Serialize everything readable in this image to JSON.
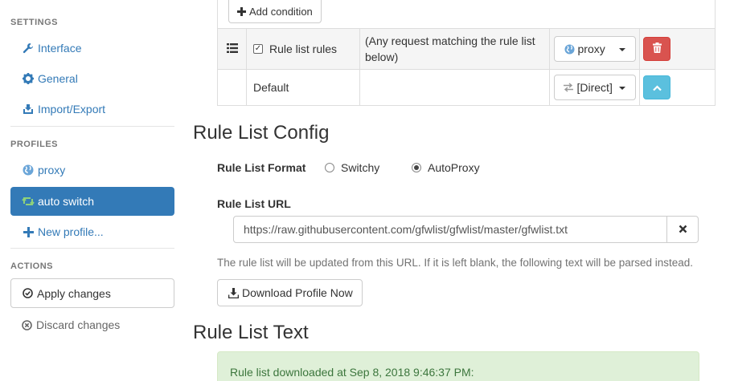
{
  "sidebar": {
    "settings_heading": "SETTINGS",
    "settings_items": [
      {
        "label": "Interface",
        "icon": "wrench-icon"
      },
      {
        "label": "General",
        "icon": "gear-icon"
      },
      {
        "label": "Import/Export",
        "icon": "import-export-icon"
      }
    ],
    "profiles_heading": "PROFILES",
    "profile_items": [
      {
        "label": "proxy",
        "icon": "globe-icon"
      },
      {
        "label": "auto switch",
        "icon": "retweet-icon"
      },
      {
        "label": "New profile...",
        "icon": "plus-icon"
      }
    ],
    "actions_heading": "ACTIONS",
    "apply_label": "Apply changes",
    "discard_label": "Discard changes"
  },
  "rules_table": {
    "add_condition_label": "Add condition",
    "rows": [
      {
        "name": "Rule list rules",
        "checked": true,
        "description": "(Any request matching the rule list below)",
        "profile": "proxy",
        "profile_icon": "globe-icon",
        "action_icon": "trash-icon"
      },
      {
        "name": "Default",
        "description": "",
        "profile": "[Direct]",
        "profile_icon": "transfer-icon",
        "action_icon": "chevron-up-icon"
      }
    ]
  },
  "rule_list_config": {
    "heading": "Rule List Config",
    "format_label": "Rule List Format",
    "format_options": [
      {
        "label": "Switchy",
        "selected": false
      },
      {
        "label": "AutoProxy",
        "selected": true
      }
    ],
    "url_label": "Rule List URL",
    "url_value": "https://raw.githubusercontent.com/gfwlist/gfwlist/master/gfwlist.txt",
    "help_text": "The rule list will be updated from this URL. If it is left blank, the following text will be parsed instead.",
    "download_label": "Download Profile Now"
  },
  "rule_list_text": {
    "heading": "Rule List Text",
    "status": "Rule list downloaded at Sep 8, 2018 9:46:37 PM:"
  },
  "colors": {
    "primary": "#337ab7",
    "danger": "#d9534f",
    "info": "#5bc0de",
    "success_bg": "#dff0d8",
    "success_text": "#3c763d"
  }
}
